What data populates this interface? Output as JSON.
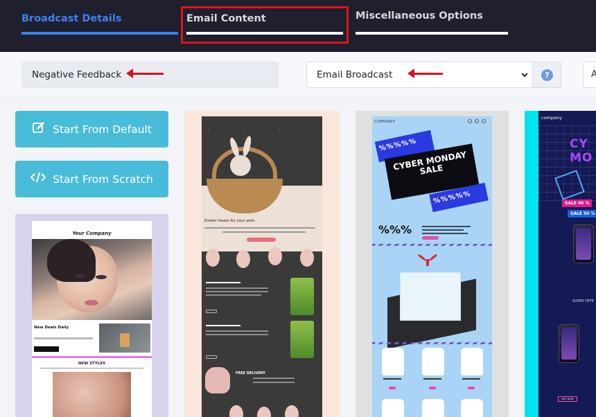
{
  "tabs": [
    {
      "label": "Broadcast Details",
      "active": true
    },
    {
      "label": "Email Content",
      "active": false,
      "highlighted": true
    },
    {
      "label": "Miscellaneous Options",
      "active": false
    }
  ],
  "form": {
    "broadcast_name_value": "Negative Feedback",
    "broadcast_type_selected": "Email Broadcast",
    "help_icon": "?",
    "extra_field_value": "A"
  },
  "actions": {
    "start_default_label": "Start From Default",
    "start_scratch_label": "Start From Scratch"
  },
  "templates": {
    "beauty": {
      "brand": "Your Company",
      "headline": "New Deals Daily",
      "section_title": "NEW STYLES"
    },
    "easter": {
      "headline": "Easter treats for your pets",
      "free_delivery": "FREE DELIVERY"
    },
    "cyber_monday": {
      "brand": "COMPANY",
      "headline": "CYBER MONDAY SALE",
      "percent_strip": "%%%%%",
      "big_percent": "%%%"
    },
    "tech": {
      "brand": "company",
      "big_text": "CY MO",
      "sale_40": "SALE 40 %",
      "sale_50": "SALE 50 %",
      "super_offer": "SUPER OFFE",
      "buy_now": "BUY NOW"
    }
  },
  "colors": {
    "topbar_bg": "#1f1f2e",
    "active_tab": "#3b82f6",
    "annotation_red": "#e0141e",
    "start_button": "#48bcd8"
  }
}
